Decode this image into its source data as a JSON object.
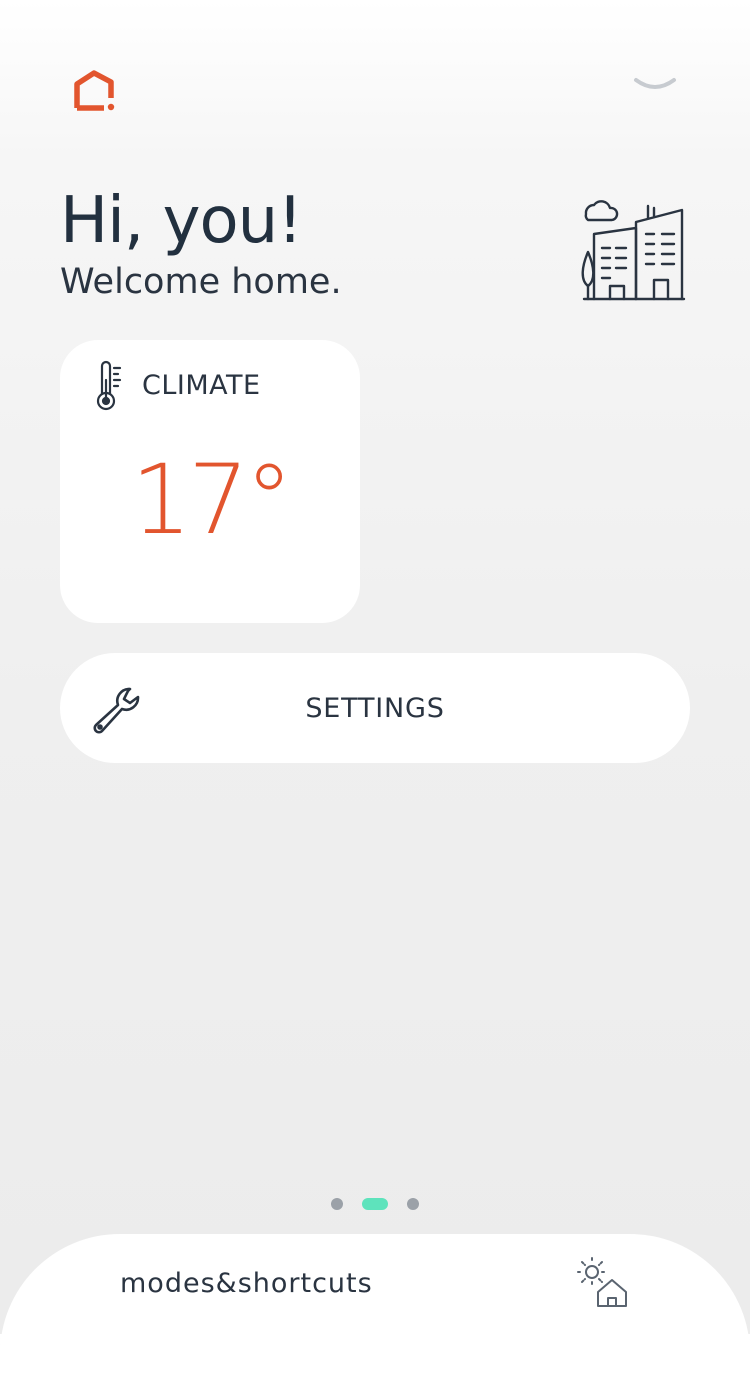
{
  "header": {
    "logo_icon": "home-logo-icon",
    "account_name": "",
    "menu_icon": "chevron-down-icon",
    "accent_color": "#e2552e"
  },
  "greeting": {
    "title": "Hi, you!",
    "subtitle": "Welcome home.",
    "illustration_icon": "buildings-icon"
  },
  "climate": {
    "label": "CLIMATE",
    "icon": "thermometer-icon",
    "temperature": "17°"
  },
  "settings": {
    "label": "SETTINGS",
    "icon": "wrench-icon"
  },
  "pager": {
    "count": 3,
    "active_index": 1,
    "active_color": "#5ee3bc"
  },
  "bottom_bar": {
    "label": "modes&shortcuts",
    "icon": "sun-house-icon"
  }
}
